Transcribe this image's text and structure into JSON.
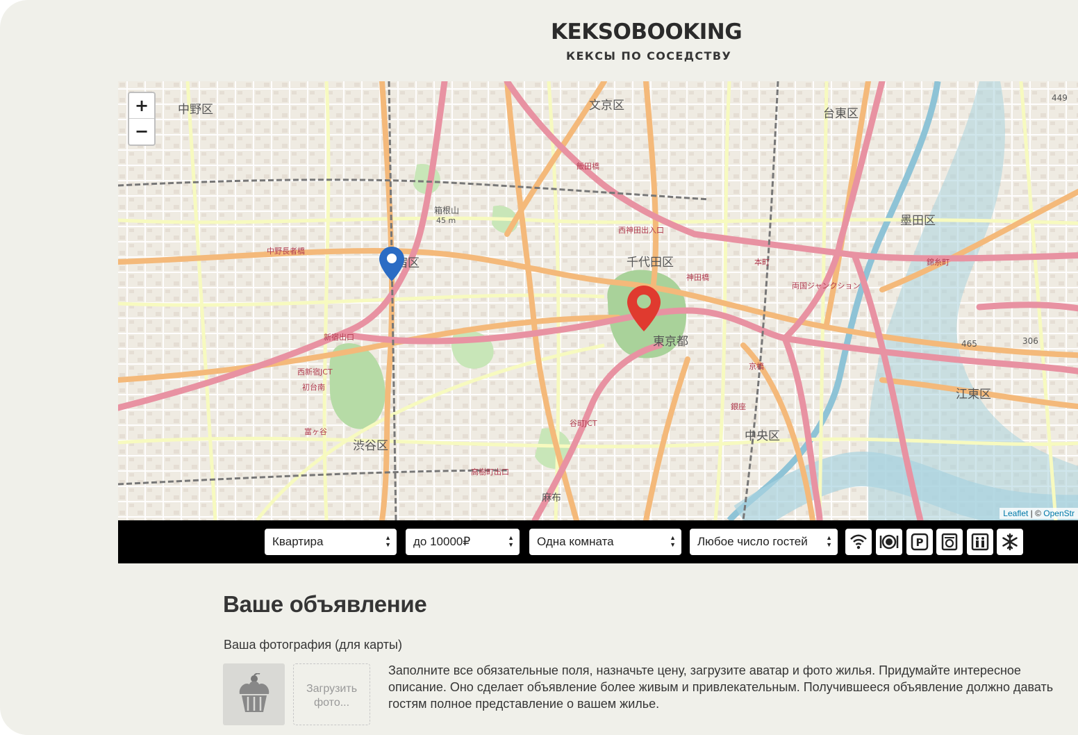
{
  "header": {
    "logo": "KEKSOBOOKING",
    "tagline": "КЕКСЫ ПО СОСЕДСТВУ"
  },
  "map": {
    "zoom_in": "+",
    "zoom_out": "−",
    "attribution_leaflet": "Leaflet",
    "attribution_sep": " | © ",
    "attribution_osm": "OpenStr",
    "labels": [
      {
        "text": "中野区"
      },
      {
        "text": "文京区"
      },
      {
        "text": "台東区"
      },
      {
        "text": "墨田区"
      },
      {
        "text": "千代田区"
      },
      {
        "text": "東京都"
      },
      {
        "text": "渋谷区"
      },
      {
        "text": "中央区"
      },
      {
        "text": "江東区"
      },
      {
        "text": "宿区"
      },
      {
        "text": "麻布"
      },
      {
        "text": "箱根山"
      },
      {
        "text": "45 m"
      },
      {
        "text": "中野長者橋"
      },
      {
        "text": "新宿出口"
      },
      {
        "text": "西新宿JCT"
      },
      {
        "text": "初台南"
      },
      {
        "text": "富ヶ谷"
      },
      {
        "text": "西神田出入口"
      },
      {
        "text": "両国ジャンクション"
      },
      {
        "text": "本町"
      },
      {
        "text": "神田橋"
      },
      {
        "text": "京橋"
      },
      {
        "text": "銀座"
      },
      {
        "text": "飯田橋"
      },
      {
        "text": "谷町JCT"
      },
      {
        "text": "高樹町出口"
      },
      {
        "text": "錦糸町"
      },
      {
        "text": "449"
      },
      {
        "text": "465"
      },
      {
        "text": "306"
      }
    ],
    "pins": [
      {
        "name": "blue-pin",
        "color": "#2b6cc4"
      },
      {
        "name": "red-pin",
        "color": "#e03a2f"
      }
    ]
  },
  "filters": {
    "type": "Квартира",
    "price": "до 10000₽",
    "rooms": "Одна комната",
    "guests": "Любое число гостей",
    "features": [
      "wifi",
      "dishwasher",
      "parking",
      "washer",
      "elevator",
      "conditioner"
    ]
  },
  "form": {
    "title": "Ваше объявление",
    "photo_label": "Ваша фотография (для карты)",
    "upload_line1": "Загрузить",
    "upload_line2": "фото...",
    "hint": "Заполните все обязательные поля, назначьте цену, загрузите аватар и фото жилья. Придумайте интересное описание. Оно сделает объявление более живым и привлекательным. Получившееся объявление должно давать гостям полное представление о вашем жилье."
  }
}
